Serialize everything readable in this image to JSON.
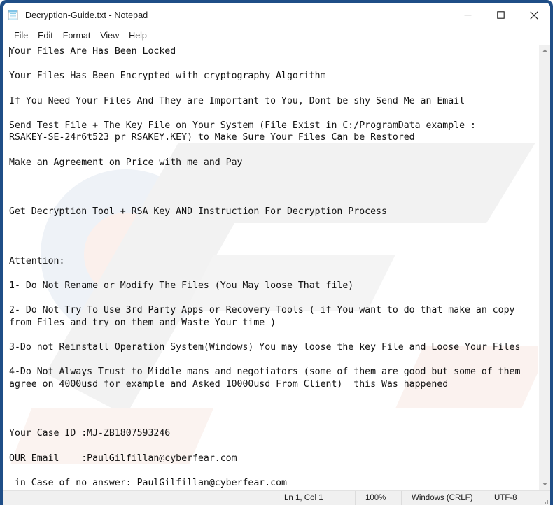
{
  "window": {
    "title": "Decryption-Guide.txt - Notepad",
    "icon": "notepad-icon",
    "border_color": "#1f4e87",
    "background_color": "#ffffff"
  },
  "caption_buttons": [
    {
      "name": "minimize",
      "glyph": "minimize-icon"
    },
    {
      "name": "maximize",
      "glyph": "maximize-icon"
    },
    {
      "name": "close",
      "glyph": "close-icon"
    }
  ],
  "menubar": {
    "items": [
      {
        "label": "File"
      },
      {
        "label": "Edit"
      },
      {
        "label": "Format"
      },
      {
        "label": "View"
      },
      {
        "label": "Help"
      }
    ]
  },
  "editor": {
    "case_id": "MJ-ZB1807593246",
    "email": "PaulGilfillan@cyberfear.com",
    "content": "Your Files Are Has Been Locked\n\nYour Files Has Been Encrypted with cryptography Algorithm\n\nIf You Need Your Files And They are Important to You, Dont be shy Send Me an Email\n\nSend Test File + The Key File on Your System (File Exist in C:/ProgramData example :\nRSAKEY-SE-24r6t523 pr RSAKEY.KEY) to Make Sure Your Files Can be Restored\n\nMake an Agreement on Price with me and Pay\n\n\n\nGet Decryption Tool + RSA Key AND Instruction For Decryption Process\n\n\n\nAttention:\n\n1- Do Not Rename or Modify The Files (You May loose That file)\n\n2- Do Not Try To Use 3rd Party Apps or Recovery Tools ( if You want to do that make an copy\nfrom Files and try on them and Waste Your time )\n\n3-Do not Reinstall Operation System(Windows) You may loose the key File and Loose Your Files\n\n4-Do Not Always Trust to Middle mans and negotiators (some of them are good but some of them\nagree on 4000usd for example and Asked 10000usd From Client)  this Was happened\n\n\n\nYour Case ID :MJ-ZB1807593246\n\nOUR Email    :PaulGilfillan@cyberfear.com\n\n in Case of no answer: PaulGilfillan@cyberfear.com"
  },
  "scrollbar": {
    "up_arrow": "scroll-up-icon",
    "down_arrow": "scroll-down-icon"
  },
  "statusbar": {
    "line_col": "Ln 1, Col 1",
    "zoom": "100%",
    "line_ending": "Windows (CRLF)",
    "encoding": "UTF-8",
    "grip": "resize-grip-icon"
  }
}
